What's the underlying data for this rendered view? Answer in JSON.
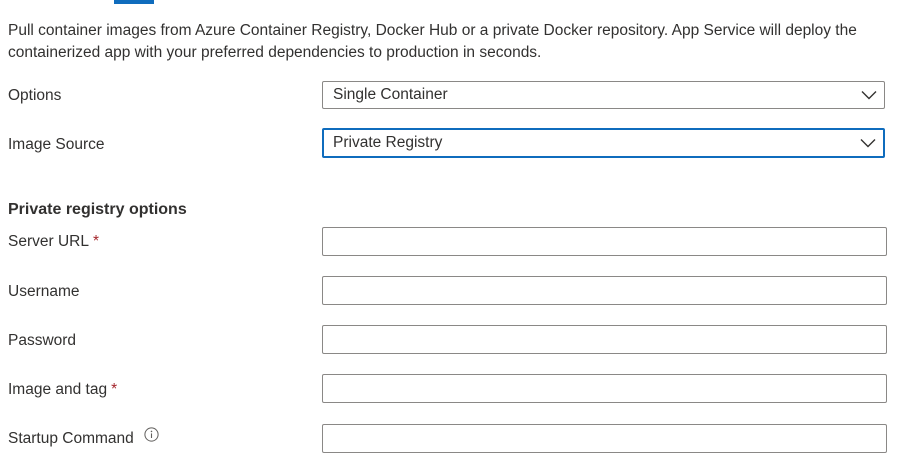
{
  "description": "Pull container images from Azure Container Registry, Docker Hub or a private Docker repository. App Service will deploy the containerized app with your preferred dependencies to production in seconds.",
  "options": {
    "label": "Options",
    "value": "Single Container"
  },
  "image_source": {
    "label": "Image Source",
    "value": "Private Registry"
  },
  "private_registry": {
    "title": "Private registry options",
    "server_url": {
      "label": "Server URL",
      "required_mark": "*",
      "value": ""
    },
    "username": {
      "label": "Username",
      "value": ""
    },
    "password": {
      "label": "Password",
      "value": ""
    },
    "image_and_tag": {
      "label": "Image and tag",
      "required_mark": "*",
      "value": ""
    },
    "startup_command": {
      "label": "Startup Command",
      "value": ""
    }
  },
  "icons": {
    "dropdown": "chevron-down-icon",
    "info": "info-icon"
  },
  "colors": {
    "accent": "#0f6cbd",
    "required": "#a4262c",
    "border": "#8a8886",
    "text": "#323130"
  }
}
